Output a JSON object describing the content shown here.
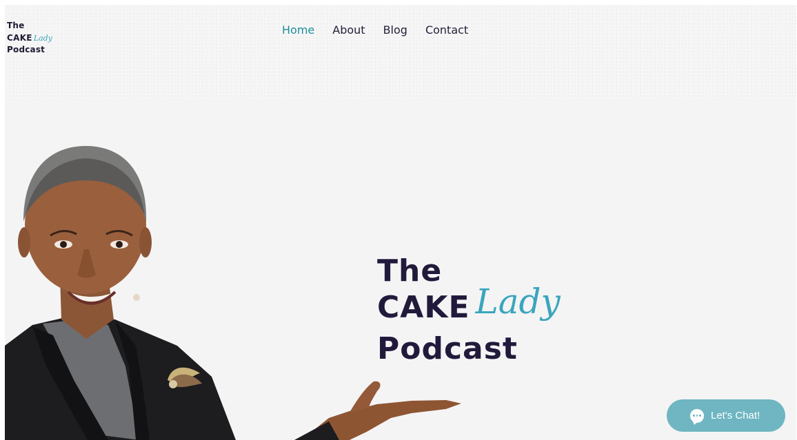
{
  "logo": {
    "line1": "The",
    "line2_word": "CAKE",
    "line2_script": "Lady",
    "line3": "Podcast"
  },
  "nav": {
    "items": [
      {
        "label": "Home",
        "active": true
      },
      {
        "label": "About",
        "active": false
      },
      {
        "label": "Blog",
        "active": false
      },
      {
        "label": "Contact",
        "active": false
      }
    ]
  },
  "hero": {
    "title_line1": "The",
    "title_word": "CAKE",
    "title_script": "Lady",
    "title_line3": "Podcast"
  },
  "chat": {
    "label": "Let's Chat!",
    "icon": "chat-bubble-icon"
  },
  "colors": {
    "accent": "#1f8e9a",
    "script": "#3aa5bd",
    "text_dark": "#221a3b",
    "chat_bg": "#6fb6c2",
    "background": "#f4f4f5"
  }
}
